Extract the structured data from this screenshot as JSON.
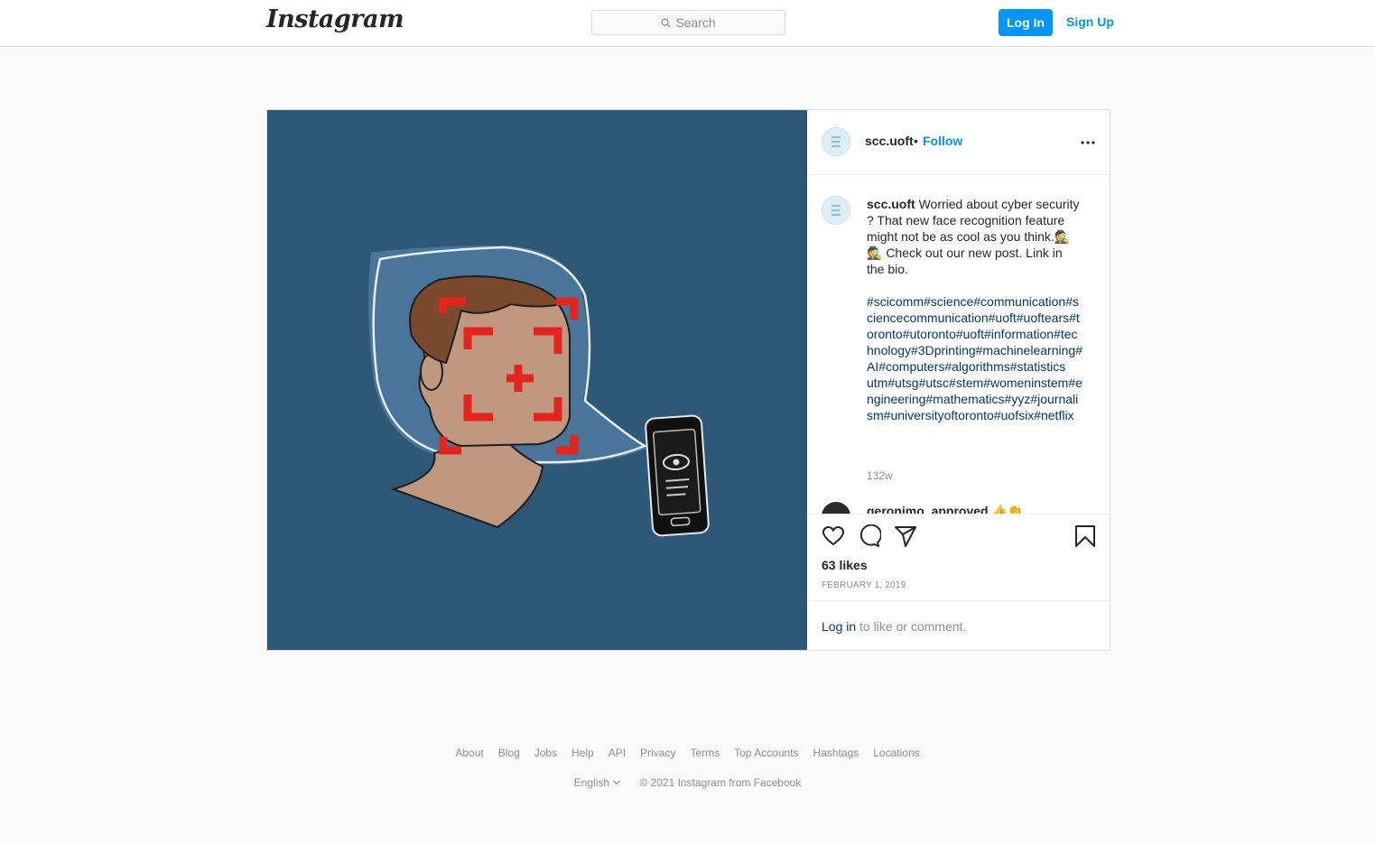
{
  "header": {
    "logo": "Instagram",
    "search_placeholder": "Search",
    "login_label": "Log In",
    "signup_label": "Sign Up"
  },
  "post": {
    "username": "scc.uoft",
    "separator": "•",
    "follow_label": "Follow",
    "caption_text": " Worried about cyber security ? That new face recognition feature might not be as cool as you think.🕵 🕵 Check out our new post. Link in the bio.",
    "hashtags": "#scicomm#science#communication#sciencecommunication#uoft#uoftears#toronto#utoronto#uoft#information#technology#3Dprinting#machinelearning#AI#computers#algorithms#statistics\nutm#utsg#utsc#stem#womeninstem#engineering#mathematics#yyz#journalism#universityoftoronto#uofsix#netflix",
    "time_ago": "132w",
    "reply_username": "geronimo_approved",
    "reply_text": " 👍👏",
    "likes": "63 likes",
    "date": "FEBRUARY 1, 2019",
    "login_link": "Log in",
    "login_rest": " to like or comment."
  },
  "footer": {
    "links": [
      "About",
      "Blog",
      "Jobs",
      "Help",
      "API",
      "Privacy",
      "Terms",
      "Top Accounts",
      "Hashtags",
      "Locations"
    ],
    "language": "English",
    "copyright": "© 2021 Instagram from Facebook"
  },
  "colors": {
    "accent": "#0095f6",
    "hashtag": "#00376b",
    "media_background": "#2e5878"
  }
}
